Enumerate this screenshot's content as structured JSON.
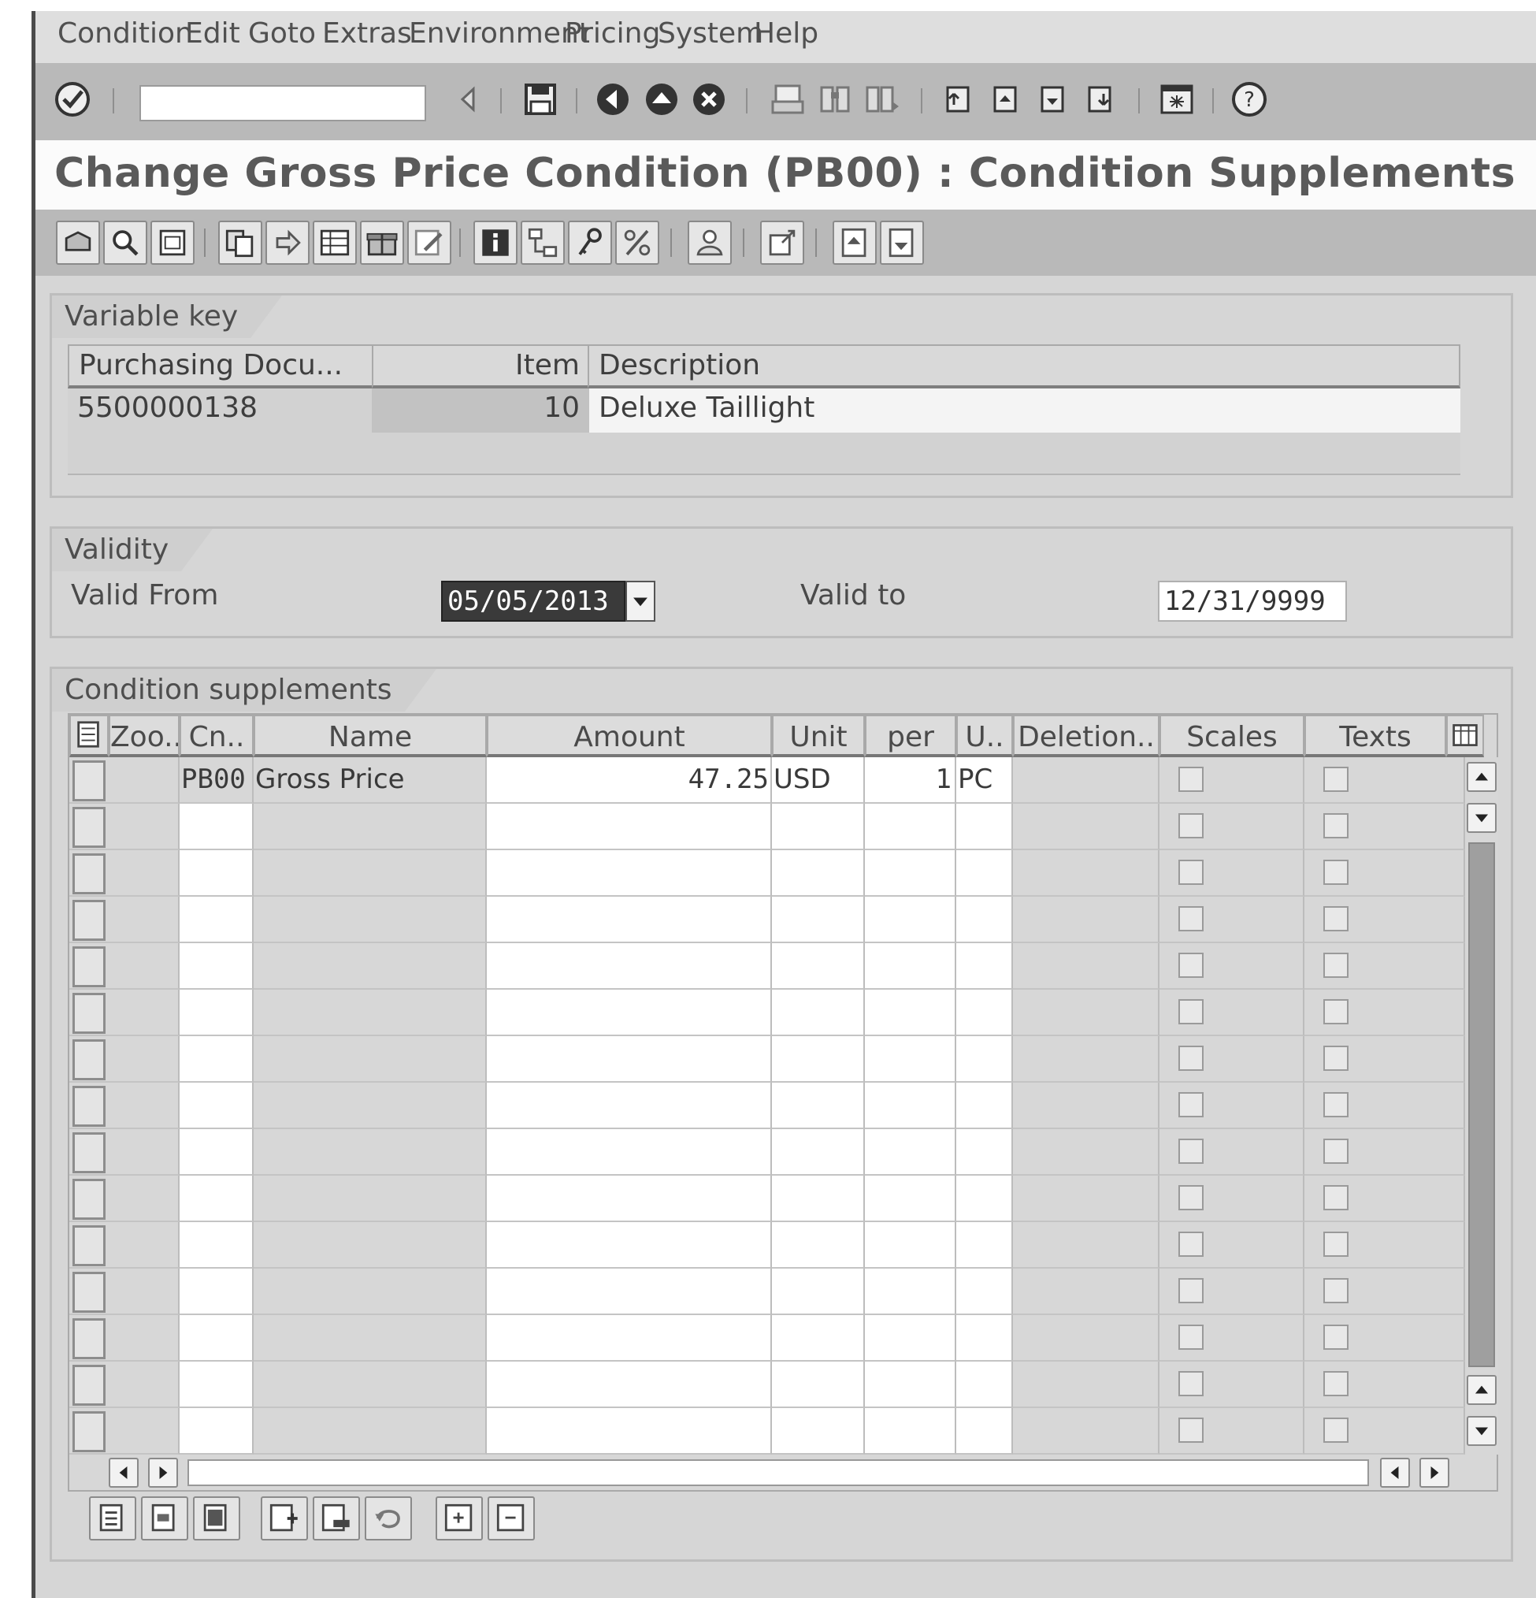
{
  "menu": [
    "Condition",
    "Edit",
    "Goto",
    "Extras",
    "Environment",
    "Pricing",
    "System",
    "Help"
  ],
  "system_toolbar": {
    "command_field_value": "",
    "icons": [
      "enter-icon",
      "back-arrow-icon",
      "save-icon",
      "back-icon",
      "exit-icon",
      "cancel-icon",
      "print-icon",
      "find-icon",
      "find-next-icon",
      "first-page-icon",
      "previous-page-icon",
      "next-page-icon",
      "last-page-icon",
      "new-session-icon",
      "help-icon"
    ]
  },
  "title": "Change Gross Price Condition (PB00) : Condition Supplements",
  "variable_key": {
    "label": "Variable key",
    "columns": [
      "Purchasing Docu...",
      "Item",
      "Description"
    ],
    "row": {
      "document": "5500000138",
      "item": "10",
      "description": "Deluxe Taillight"
    }
  },
  "validity": {
    "label": "Validity",
    "valid_from_label": "Valid From",
    "valid_from": "05/05/2013",
    "valid_to_label": "Valid to",
    "valid_to": "12/31/9999"
  },
  "supplements": {
    "label": "Condition supplements",
    "columns": [
      "Zoo..",
      "Cn..",
      "Name",
      "Amount",
      "Unit",
      "per",
      "U..",
      "Deletion..",
      "Scales",
      "Texts"
    ],
    "rows": [
      {
        "zoo": "",
        "cn": "PB00",
        "name": "Gross Price",
        "amount": "47.25",
        "unit": "USD",
        "per": "1",
        "uom": "PC",
        "deletion": "",
        "scales": false,
        "texts": false
      }
    ],
    "empty_rows": 14
  },
  "colors": {
    "selected_field_bg": "#3a3a3a",
    "selected_field_text": "#ffffff",
    "toolbar_bg": "#b9b9b9",
    "panel_bg": "#d6d6d6"
  }
}
